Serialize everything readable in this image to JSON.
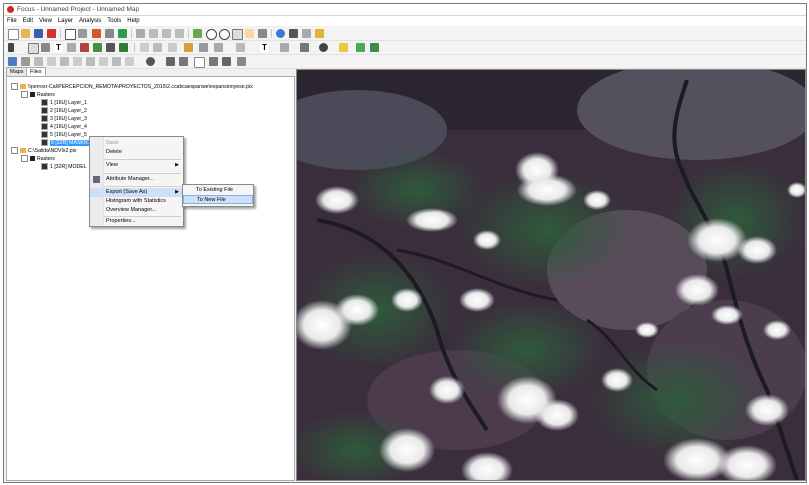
{
  "window": {
    "title": "Focus - Unnamed Project - Unnamed Map"
  },
  "menubar": [
    "File",
    "Edit",
    "View",
    "Layer",
    "Analysis",
    "Tools",
    "Help"
  ],
  "tabs": {
    "maps": "Maps",
    "files": "Files"
  },
  "tree": {
    "file1_path": "\\\\perrosr-Cal\\PERCEPCION_REMOTA\\PROYECTOS_2015\\2.ccabcaexpanwe\\expansionyese.pix",
    "rasters_label": "Rasters",
    "layers": [
      "1 [16U] Layer_1",
      "2 [16U] Layer_2",
      "3 [16U] Layer_3",
      "4 [16U] Layer_4",
      "5 [16U] Layer_5",
      "6 [32R] MASKN..."
    ],
    "file2_path": "C:\\Salida\\NDVIx2.pix",
    "rasters2_label": "Rasters",
    "layers2": [
      "1 [32R] MODEL"
    ]
  },
  "context_menu": {
    "save": "Save",
    "delete": "Delete",
    "view": "View",
    "attribute_manager": "Attribute Manager...",
    "export": "Export (Save As)",
    "histogram": "Histogram with Statistics",
    "overview": "Overview Manager...",
    "properties": "Properties..."
  },
  "submenu": {
    "existing": "To Existing File",
    "new": "To New File"
  },
  "icons": [
    "new-icon",
    "open-icon",
    "save-icon",
    "pan-icon",
    "zoom-icon",
    "info-icon"
  ],
  "colors": {
    "selection": "#3399ff",
    "menu_highlight": "#cde0f5"
  }
}
